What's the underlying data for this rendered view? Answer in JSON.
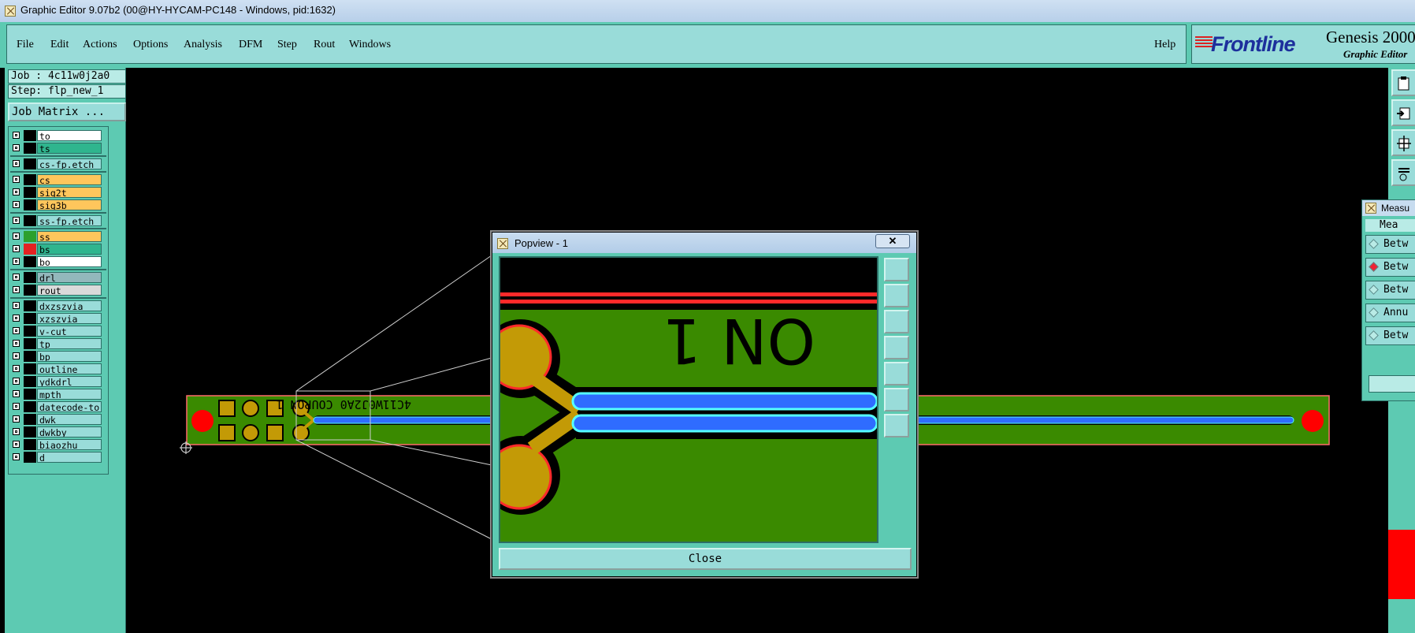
{
  "window": {
    "title": "Graphic Editor 9.07b2 (00@HY-HYCAM-PC148 - Windows, pid:1632)"
  },
  "menu": {
    "file": "File",
    "edit": "Edit",
    "actions": "Actions",
    "options": "Options",
    "analysis": "Analysis",
    "dfm": "DFM",
    "step": "Step",
    "rout": "Rout",
    "windows": "Windows",
    "help": "Help"
  },
  "logo": {
    "brand": "Frontline",
    "product": "Genesis 2000",
    "subtitle": "Graphic Editor"
  },
  "job": {
    "job_label": "Job : 4c11w0j2a0",
    "step_label": "Step: flp_new_1",
    "matrix_button": "Job Matrix ..."
  },
  "layers": [
    {
      "name": "to",
      "color": "#ffffff",
      "swatch": "#000000"
    },
    {
      "name": "ts",
      "color": "#2fb58e",
      "swatch": "#000000"
    },
    {
      "name": "cs-fp.etch",
      "color": "#99dcd9",
      "swatch": "#000000"
    },
    {
      "name": "cs",
      "color": "#ffc65c",
      "swatch": "#000000"
    },
    {
      "name": "sig2t",
      "color": "#ffc65c",
      "swatch": "#000000"
    },
    {
      "name": "sig3b",
      "color": "#ffc65c",
      "swatch": "#000000"
    },
    {
      "name": "ss-fp.etch",
      "color": "#99dcd9",
      "swatch": "#000000"
    },
    {
      "name": "ss",
      "color": "#ffc65c",
      "swatch": "#2ca02c"
    },
    {
      "name": "bs",
      "color": "#2fb58e",
      "swatch": "#e32222"
    },
    {
      "name": "bo",
      "color": "#ffffff",
      "swatch": "#000000"
    },
    {
      "name": "drl",
      "color": "#93b8bc",
      "swatch": "#000000"
    },
    {
      "name": "rout",
      "color": "#dadada",
      "swatch": "#000000"
    },
    {
      "name": "dxzszvia",
      "color": "#99dcd9",
      "swatch": "#000000"
    },
    {
      "name": "xzszvia",
      "color": "#99dcd9",
      "swatch": "#000000"
    },
    {
      "name": "v-cut",
      "color": "#99dcd9",
      "swatch": "#000000"
    },
    {
      "name": "tp",
      "color": "#99dcd9",
      "swatch": "#000000"
    },
    {
      "name": "bp",
      "color": "#99dcd9",
      "swatch": "#000000"
    },
    {
      "name": "outline",
      "color": "#99dcd9",
      "swatch": "#000000"
    },
    {
      "name": "ydkdrl",
      "color": "#99dcd9",
      "swatch": "#000000"
    },
    {
      "name": "mpth",
      "color": "#99dcd9",
      "swatch": "#000000"
    },
    {
      "name": "datecode-to",
      "color": "#99dcd9",
      "swatch": "#000000"
    },
    {
      "name": "dwk",
      "color": "#99dcd9",
      "swatch": "#000000"
    },
    {
      "name": "dwkby",
      "color": "#99dcd9",
      "swatch": "#000000"
    },
    {
      "name": "biaozhu",
      "color": "#99dcd9",
      "swatch": "#000000"
    },
    {
      "name": "d",
      "color": "#99dcd9",
      "swatch": "#000000"
    }
  ],
  "board": {
    "text": "4C11W0J2A0 COUPON 1"
  },
  "popview": {
    "title": "Popview - 1",
    "close_label": "Close",
    "close_x": "✕",
    "zoom_text": "ON 1"
  },
  "measure": {
    "title": "Measu",
    "header": "Mea",
    "items": [
      "Betw",
      "Betw",
      "Betw",
      "Annu",
      "Betw"
    ],
    "selected_index": 1
  },
  "colors": {
    "panel": "#5dcab2",
    "panel_light": "#99dcd9",
    "board": "#3a8a00",
    "trace": "#2f6cff",
    "pad": "#c39a06",
    "red": "#ff0000"
  }
}
